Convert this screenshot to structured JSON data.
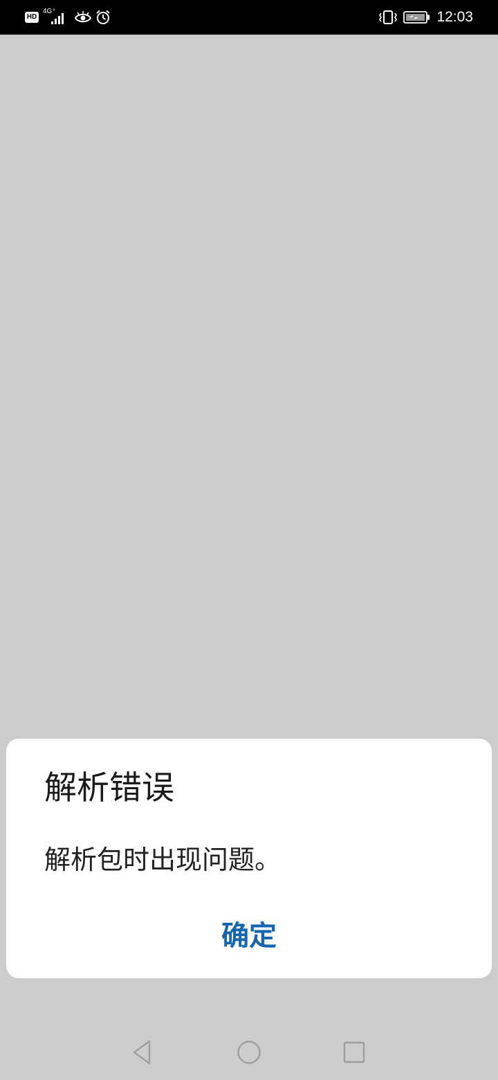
{
  "status_bar": {
    "left_icons": [
      "hd-badge-icon",
      "signal-4g-icon",
      "eye-icon",
      "alarm-icon"
    ],
    "hd_label": "HD",
    "network_label": "4G⁺",
    "right_icons": [
      "vibrate-icon",
      "battery-charging-icon"
    ],
    "time": "12:03"
  },
  "dialog": {
    "title": "解析错误",
    "message": "解析包时出现问题。",
    "confirm_label": "确定"
  },
  "colors": {
    "background": "#cccccc",
    "status_bar": "#000000",
    "dialog_bg": "#ffffff",
    "accent": "#1565b0"
  },
  "nav_bar": {
    "buttons": [
      "back-icon",
      "home-icon",
      "recents-icon"
    ]
  }
}
